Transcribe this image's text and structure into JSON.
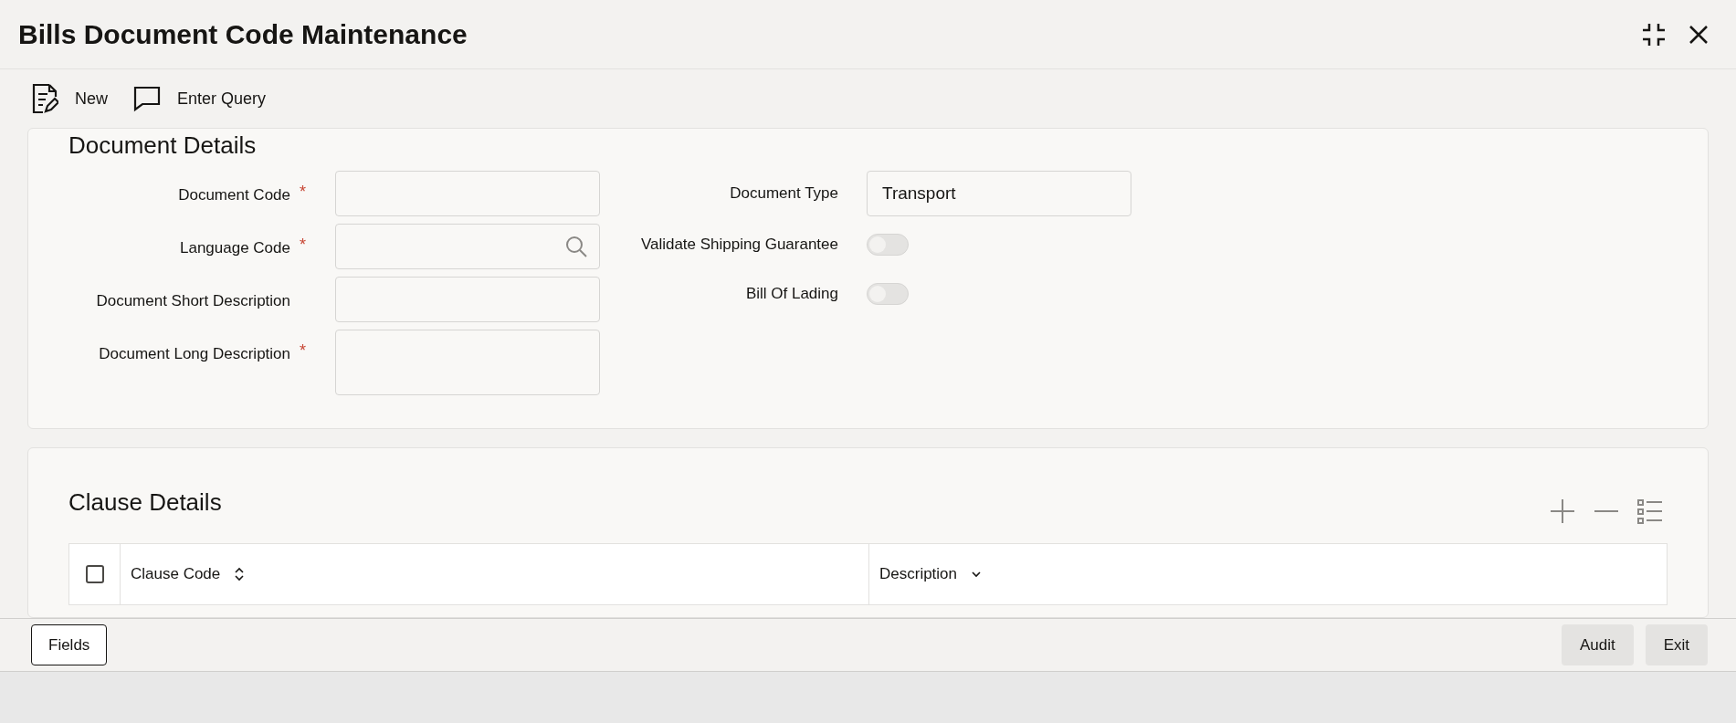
{
  "window": {
    "title": "Bills Document Code Maintenance"
  },
  "toolbar": [
    {
      "kind": "new",
      "label": "New"
    },
    {
      "kind": "query",
      "label": "Enter Query"
    }
  ],
  "document_details": {
    "heading": "Document Details",
    "left_fields": [
      {
        "kind": "text",
        "label": "Document Code",
        "required_mark": "*"
      },
      {
        "kind": "lookup",
        "label": "Language Code",
        "required_mark": "*"
      },
      {
        "kind": "text",
        "label": "Document Short Description"
      },
      {
        "kind": "textarea",
        "label": "Document Long Description",
        "required_mark": "*"
      }
    ],
    "right_fields": [
      {
        "kind": "text",
        "label": "Document Type",
        "value": "Transport"
      },
      {
        "kind": "toggle",
        "label": "Validate Shipping Guarantee",
        "on": false
      },
      {
        "kind": "toggle",
        "label": "Bill Of Lading",
        "on": false
      }
    ]
  },
  "clause_details": {
    "heading": "Clause Details",
    "select_all_checked": false,
    "columns": [
      {
        "label": "Clause Code",
        "kind": "sortable"
      },
      {
        "label": "Description",
        "kind": "dropdown"
      }
    ]
  },
  "footer": {
    "left_buttons": [
      "Fields"
    ],
    "right_buttons": [
      "Audit",
      "Exit"
    ]
  }
}
